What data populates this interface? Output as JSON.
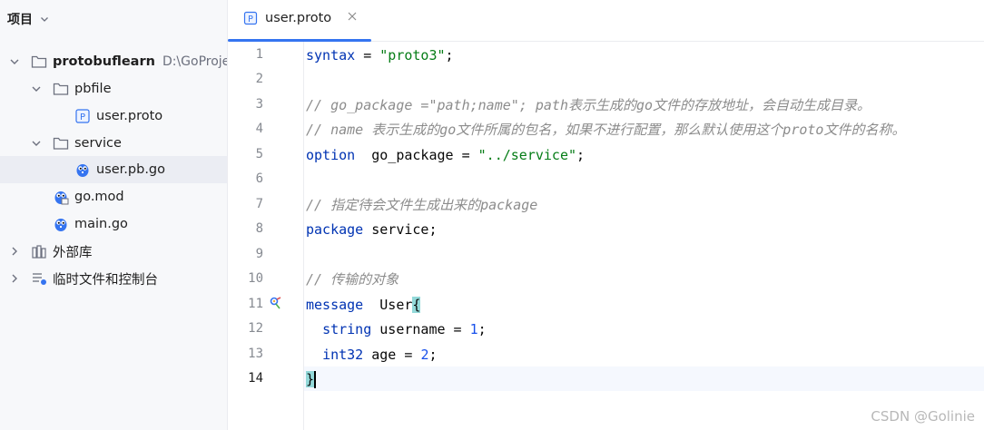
{
  "sidebar": {
    "title": "项目",
    "rows": [
      {
        "label": "protobuflearn",
        "hint": "D:\\GoProje",
        "bold": true
      },
      {
        "label": "pbfile"
      },
      {
        "label": "user.proto"
      },
      {
        "label": "service"
      },
      {
        "label": "user.pb.go"
      },
      {
        "label": "go.mod"
      },
      {
        "label": "main.go"
      },
      {
        "label": "外部库"
      },
      {
        "label": "临时文件和控制台"
      }
    ]
  },
  "editor": {
    "tab": {
      "label": "user.proto",
      "icon": "proto-file-icon"
    },
    "line_numbers": [
      "1",
      "2",
      "3",
      "4",
      "5",
      "6",
      "7",
      "8",
      "9",
      "10",
      "11",
      "12",
      "13",
      "14"
    ],
    "current_line": 14,
    "lines": {
      "l1": {
        "kw": "syntax",
        "op": " = ",
        "str": "\"proto3\"",
        "end": ";"
      },
      "l3": "// go_package =\"path;name\"; path表示生成的go文件的存放地址，会自动生成目录。",
      "l4": "// name 表示生成的go文件所属的包名，如果不进行配置，那么默认使用这个proto文件的名称。",
      "l5": {
        "kw": "option",
        "mid": "  go_package = ",
        "str": "\"../service\"",
        "end": ";"
      },
      "l7": "// 指定待会文件生成出来的package",
      "l8": {
        "kw": "package",
        "rest": " service;"
      },
      "l10": "// 传输的对象",
      "l11": {
        "kw": "message",
        "name": "  User",
        "brace": "{"
      },
      "l12": {
        "indent": "  ",
        "kw": "string",
        "mid": " username = ",
        "num": "1",
        "end": ";"
      },
      "l13": {
        "indent": "  ",
        "kw": "int32",
        "mid": " age = ",
        "num": "2",
        "end": ";"
      },
      "l14": {
        "brace": "}"
      }
    }
  },
  "watermark": "CSDN @Golinie",
  "colors": {
    "keyword": "#0033b3",
    "string": "#067d17",
    "number": "#1750eb",
    "comment": "#8c8c8c",
    "accent": "#3574f0",
    "brace_highlight": "#93d9d9"
  }
}
